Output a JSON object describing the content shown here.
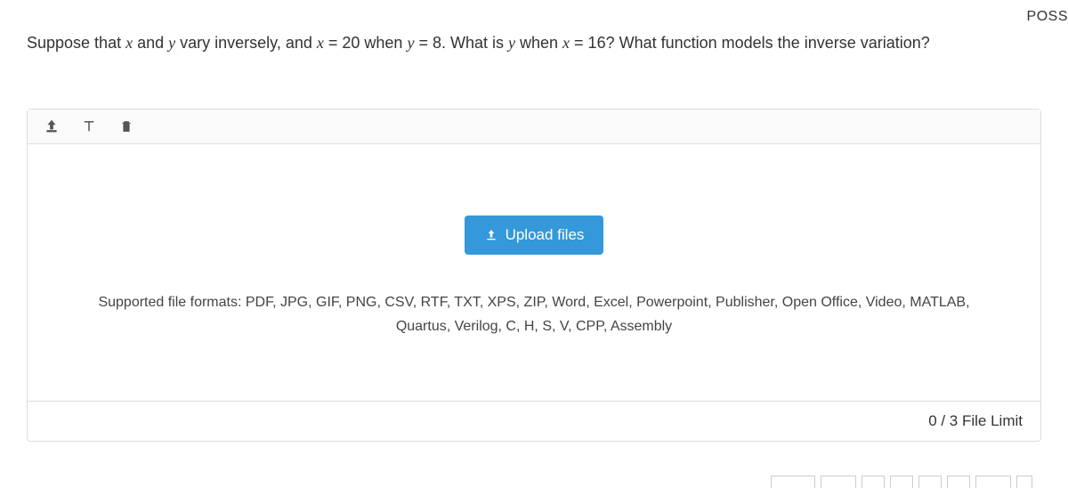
{
  "header": {
    "top_right_label": "POSS"
  },
  "question": {
    "part1": "Suppose that ",
    "var_x": "x",
    "part2": " and ",
    "var_y": "y",
    "part3": " vary inversely, and ",
    "var_x2": "x",
    "part4": " = 20 when ",
    "var_y2": "y",
    "part5": " = 8. What is ",
    "var_y3": "y",
    "part6": " when ",
    "var_x3": "x",
    "part7": " = 16? What function models the inverse variation?"
  },
  "upload": {
    "button_label": "Upload files",
    "supported_formats": "Supported file formats: PDF, JPG, GIF, PNG, CSV, RTF, TXT, XPS, ZIP, Word, Excel, Powerpoint, Publisher, Open Office, Video, MATLAB, Quartus, Verilog, C, H, S, V, CPP, Assembly",
    "file_limit": "0 / 3 File Limit"
  }
}
